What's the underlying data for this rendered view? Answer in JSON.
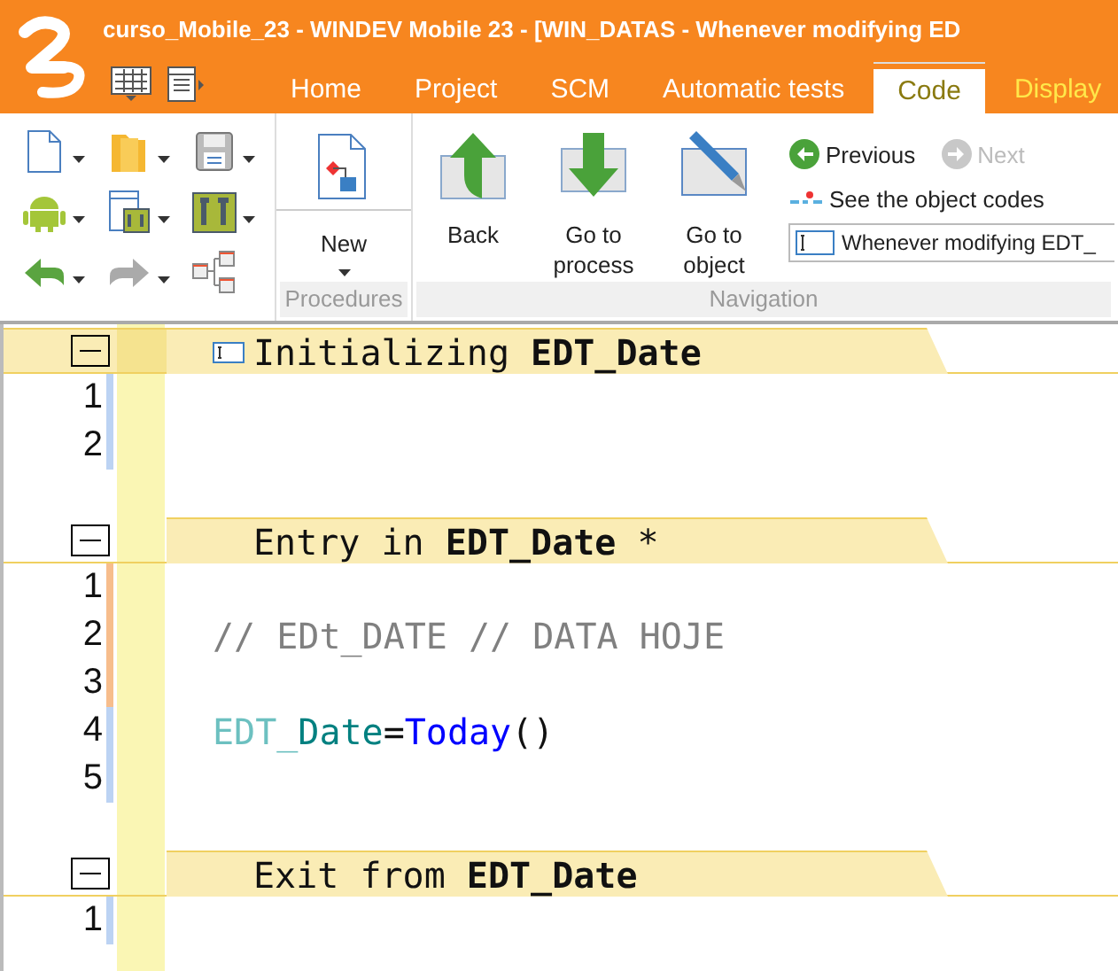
{
  "title_bar": {
    "title": "curso_Mobile_23 - WINDEV Mobile 23 - [WIN_DATAS - Whenever modifying ED"
  },
  "tabs": [
    {
      "label": "Home",
      "selected": false,
      "contextual": false
    },
    {
      "label": "Project",
      "selected": false,
      "contextual": false
    },
    {
      "label": "SCM",
      "selected": false,
      "contextual": false
    },
    {
      "label": "Automatic tests",
      "selected": false,
      "contextual": false
    },
    {
      "label": "Code",
      "selected": true,
      "contextual": false
    },
    {
      "label": "Display",
      "selected": false,
      "contextual": true
    }
  ],
  "ribbon": {
    "groups": [
      {
        "label": "Procedures",
        "buttons": [
          {
            "label": "New",
            "dropdown": true
          }
        ]
      },
      {
        "label": "Navigation",
        "buttons": [
          {
            "label": "Back",
            "dropdown": false
          },
          {
            "label": "Go to process",
            "dropdown": false
          },
          {
            "label": "Go to object",
            "dropdown": false
          }
        ],
        "links": [
          {
            "label": "Previous",
            "disabled": false
          },
          {
            "label": "Next",
            "disabled": true
          }
        ],
        "object_codes": "See the object codes",
        "event_field": {
          "value": "Whenever modifying EDT_"
        }
      }
    ]
  },
  "editor": {
    "sections": [
      {
        "title": "Initializing **EDT_Date**",
        "current": true,
        "lines": [
          {
            "number": "1",
            "modified": false
          },
          {
            "number": "2",
            "modified": false
          }
        ]
      },
      {
        "title": "Entry in **EDT_Date** *",
        "current": false,
        "lines": [
          {
            "number": "1",
            "modified": true
          },
          {
            "number": "2",
            "modified": true,
            "tokens": [
              {
                "text": "// EDt_DATE // DATA HOJE",
                "kind": "comment"
              }
            ]
          },
          {
            "number": "3",
            "modified": true
          },
          {
            "number": "4",
            "modified": false,
            "tokens": [
              {
                "text": "EDT_",
                "kind": "control-prefix"
              },
              {
                "text": "Date",
                "kind": "control"
              },
              {
                "text": "=",
                "kind": "operator"
              },
              {
                "text": "Today",
                "kind": "function"
              },
              {
                "text": "()",
                "kind": "operator"
              }
            ]
          },
          {
            "number": "5",
            "modified": false
          }
        ]
      },
      {
        "title": "Exit from **EDT_Date**",
        "current": false,
        "lines": [
          {
            "number": "1",
            "modified": false
          }
        ]
      }
    ]
  }
}
